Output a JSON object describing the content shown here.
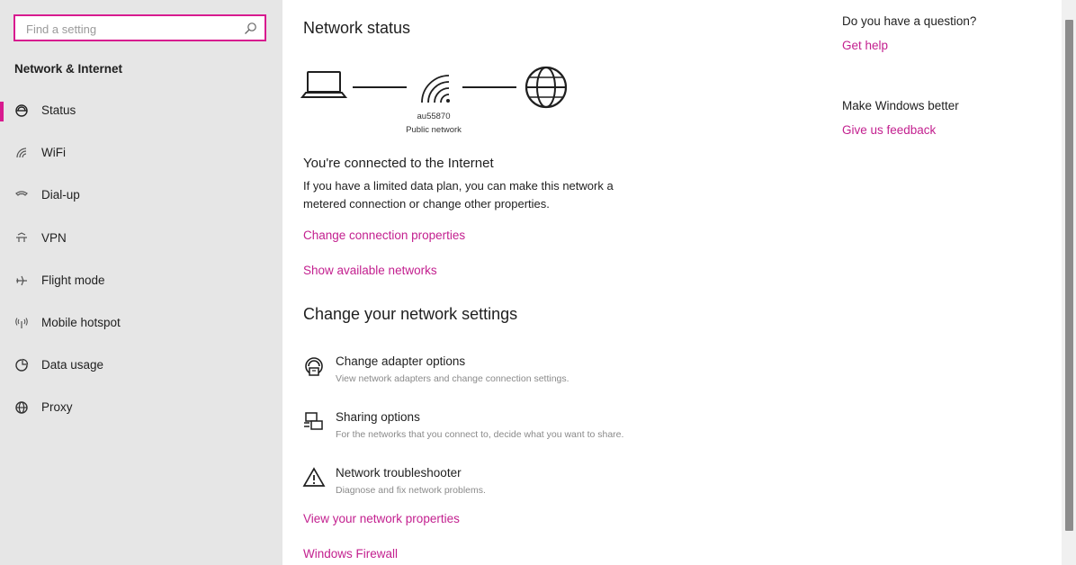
{
  "search": {
    "placeholder": "Find a setting"
  },
  "sidebar": {
    "title": "Network & Internet",
    "items": [
      {
        "label": "Status",
        "icon": "status-icon",
        "selected": true
      },
      {
        "label": "WiFi",
        "icon": "wifi-icon"
      },
      {
        "label": "Dial-up",
        "icon": "dialup-icon"
      },
      {
        "label": "VPN",
        "icon": "vpn-icon"
      },
      {
        "label": "Flight mode",
        "icon": "airplane-icon"
      },
      {
        "label": "Mobile hotspot",
        "icon": "hotspot-icon"
      },
      {
        "label": "Data usage",
        "icon": "data-usage-icon"
      },
      {
        "label": "Proxy",
        "icon": "proxy-icon"
      }
    ]
  },
  "main": {
    "title": "Network status",
    "network_name": "au55870",
    "network_type": "Public network",
    "connected_heading": "You're connected to the Internet",
    "connected_text_line1": "If you have a limited data plan, you can make this network a",
    "connected_text_line2": "metered connection or change other properties.",
    "link_change_connection": "Change connection properties",
    "link_show_networks": "Show available networks",
    "change_heading": "Change your network settings",
    "options": [
      {
        "title": "Change adapter options",
        "desc": "View network adapters and change connection settings.",
        "icon": "adapter-icon"
      },
      {
        "title": "Sharing options",
        "desc": "For the networks that you connect to, decide what you want to share.",
        "icon": "sharing-icon"
      },
      {
        "title": "Network troubleshooter",
        "desc": "Diagnose and fix network problems.",
        "icon": "warning-icon"
      }
    ],
    "link_view_properties": "View your network properties",
    "link_firewall": "Windows Firewall"
  },
  "right": {
    "question": "Do you have a question?",
    "get_help": "Get help",
    "make_better": "Make Windows better",
    "feedback": "Give us feedback"
  },
  "colors": {
    "accent": "#c3208f",
    "sidebar_bg": "#e6e6e6",
    "search_border": "#d81b8f"
  }
}
